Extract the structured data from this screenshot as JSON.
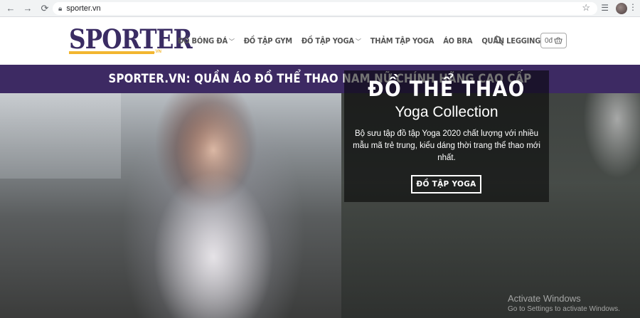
{
  "browser": {
    "url": "sporter.vn"
  },
  "header": {
    "logo_text": "SPORTER",
    "logo_tld": ".VN",
    "menu": [
      {
        "label": "ĐỒ BÓNG ĐÁ",
        "has_dropdown": true
      },
      {
        "label": "ĐỒ TẬP GYM",
        "has_dropdown": false
      },
      {
        "label": "ĐỒ TẬP YOGA",
        "has_dropdown": true
      },
      {
        "label": "THẢM TẬP YOGA",
        "has_dropdown": false
      },
      {
        "label": "ÁO BRA",
        "has_dropdown": false
      },
      {
        "label": "QUẦN LEGGING",
        "has_dropdown": false
      }
    ],
    "cart_total": "0đ"
  },
  "banner": {
    "text": "SPORTER.VN: QUẦN ÁO ĐỒ THỂ THAO NAM NỮ CHÍNH HÃNG CAO CẤP"
  },
  "hero": {
    "title": "ĐỒ THỂ THAO",
    "subtitle": "Yoga Collection",
    "description": "Bộ sưu tập đồ tập Yoga 2020 chất lượng với nhiều mẫu mã trẻ trung, kiểu dáng thời trang thể thao mới nhất.",
    "button_label": "ĐỒ TẬP YOGA"
  },
  "os_watermark": {
    "title": "Activate Windows",
    "subtitle": "Go to Settings to activate Windows."
  },
  "colors": {
    "brand_purple": "#3d2a63",
    "logo_yellow": "#f2b630"
  }
}
